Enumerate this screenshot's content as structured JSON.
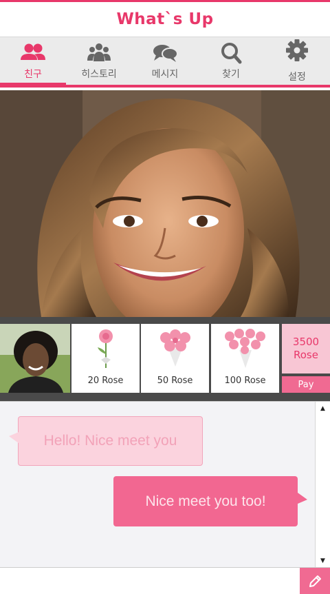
{
  "header": {
    "title": "What`s Up"
  },
  "tabs": [
    {
      "label": "친구",
      "icon": "friends-icon",
      "active": true
    },
    {
      "label": "히스토리",
      "icon": "group-icon",
      "active": false
    },
    {
      "label": "메시지",
      "icon": "chat-bubbles-icon",
      "active": false
    },
    {
      "label": "찾기",
      "icon": "search-icon",
      "active": false
    },
    {
      "label": "설정",
      "icon": "gear-icon",
      "active": false
    }
  ],
  "gifts": [
    {
      "label": "20 Rose",
      "icon": "single-rose-icon"
    },
    {
      "label": "50 Rose",
      "icon": "rose-bouquet-icon"
    },
    {
      "label": "100 Rose",
      "icon": "large-rose-bouquet-icon"
    }
  ],
  "price": {
    "amount": "3500",
    "unit": "Rose",
    "pay_label": "Pay"
  },
  "messages": [
    {
      "direction": "in",
      "text": "Hello! Nice meet you"
    },
    {
      "direction": "out",
      "text": "Nice meet you too!"
    }
  ],
  "input": {
    "placeholder": "",
    "value": ""
  },
  "colors": {
    "accent": "#e8386a",
    "bubble_out": "#f26791",
    "bubble_in": "#fbd3de"
  }
}
